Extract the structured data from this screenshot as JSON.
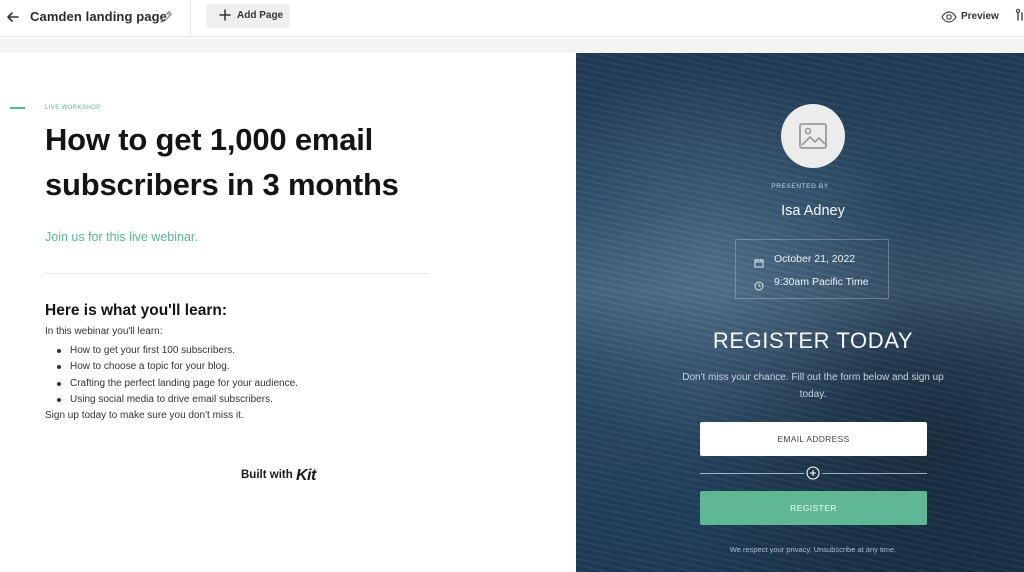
{
  "toolbar": {
    "page_name": "Camden landing page",
    "add_page_label": "Add Page",
    "preview_label": "Preview"
  },
  "landing": {
    "eyebrow": "LIVE WORKSHOP",
    "headline": "How to get 1,000 email subscribers in 3 months",
    "subheading": "Join us for this live webinar.",
    "learn_title": "Here is what you'll learn:",
    "learn_intro": "In this webinar you'll learn:",
    "learn_items": [
      {
        "text": "How to get your first 100 subscribers."
      },
      {
        "text": "How to choose a topic for your blog."
      },
      {
        "text": "Crafting the perfect landing page for your audience."
      },
      {
        "text": "Using social media to drive email subscribers."
      }
    ],
    "learn_outro": "Sign up today to make sure you don't miss it.",
    "built_with": "Built with",
    "brand": "Kit"
  },
  "signup": {
    "presented_by": "PRESENTED BY",
    "presenter": "Isa Adney",
    "date": "October 21, 2022",
    "time": "9:30am Pacific Time",
    "register_heading": "REGISTER TODAY",
    "register_sub": "Don't miss your chance. Fill out the form below and sign up today.",
    "email_placeholder": "EMAIL ADDRESS",
    "button_label": "REGISTER",
    "privacy": "We respect your privacy. Unsubscribe at any time."
  },
  "icons": {
    "back": "arrow-left-icon",
    "edit": "pencil-icon",
    "add": "plus-icon",
    "preview": "eye-icon",
    "avatar": "image-placeholder-icon",
    "date": "calendar-icon",
    "time": "clock-icon",
    "add_field": "plus-circle-icon"
  },
  "colors": {
    "accent": "#5bb597",
    "button": "#5fb893",
    "panel": "#2a4a66"
  }
}
